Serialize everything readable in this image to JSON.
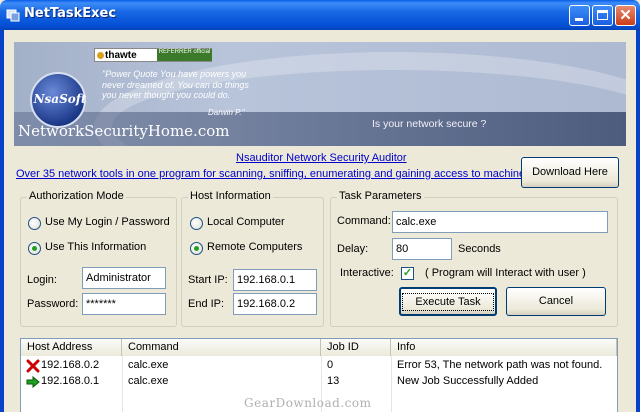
{
  "window": {
    "title": "NetTaskExec"
  },
  "banner": {
    "thawte_name": "thawte",
    "thawte_badge": "REFERRER official",
    "logo_text": "NsaSoft",
    "quote": "\"Power Quote You have powers you never dreamed of. You can do things you never thought you could do.",
    "quote_author": "Darwin P.\"",
    "site_name": "NetworkSecurityHome.com",
    "tagline": "Is your network secure ?"
  },
  "promo": {
    "title_link": "Nsauditor Network Security Auditor",
    "desc_link": "Over 35 network tools in one program for scanning, sniffing, enumerating and gaining access to machines.",
    "download_label": "Download Here"
  },
  "auth": {
    "title": "Authorization Mode",
    "option_my_login": "Use My Login / Password",
    "option_this_info": "Use This Information",
    "selected": "this_info",
    "login_label": "Login:",
    "login_value": "Administrator",
    "password_label": "Password:",
    "password_value": "*******"
  },
  "host": {
    "title": "Host Information",
    "option_local": "Local Computer",
    "option_remote": "Remote Computers",
    "selected": "remote",
    "start_ip_label": "Start IP:",
    "start_ip_value": "192.168.0.1",
    "end_ip_label": "End IP:",
    "end_ip_value": "192.168.0.2"
  },
  "task": {
    "title": "Task Parameters",
    "command_label": "Command:",
    "command_value": "calc.exe",
    "delay_label": "Delay:",
    "delay_value": "80",
    "delay_unit": "Seconds",
    "interactive_label": "Interactive:",
    "interactive_checked": true,
    "interactive_note": "( Program will Interact with user )",
    "execute_label": "Execute Task",
    "cancel_label": "Cancel"
  },
  "results": {
    "columns": [
      "Host Address",
      "Command",
      "Job ID",
      "Info"
    ],
    "rows": [
      {
        "status": "error",
        "status_icon": "red-x-icon",
        "host": "192.168.0.2",
        "command": "calc.exe",
        "job_id": "0",
        "info": "Error 53, The network path was not found."
      },
      {
        "status": "success",
        "status_icon": "green-arrow-icon",
        "host": "192.168.0.1",
        "command": "calc.exe",
        "job_id": "13",
        "info": "New Job Successfully Added"
      }
    ]
  },
  "watermark": "GearDownload.com",
  "colors": {
    "titlebar": "#0a5ee8",
    "link": "#0000cc",
    "error_icon": "#cc0000",
    "success_icon": "#20a020"
  }
}
